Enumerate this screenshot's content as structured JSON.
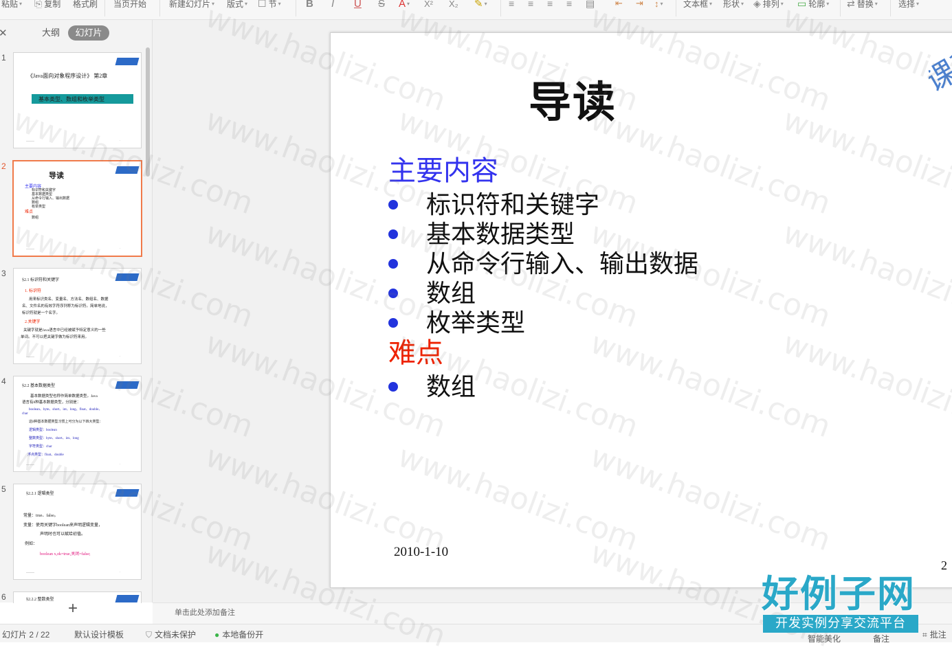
{
  "toolbar": {
    "paste": "粘贴",
    "copy": "复制",
    "format_painter": "格式刷",
    "current_page_start": "当页开始",
    "new_slide": "新建幻灯片",
    "layout": "版式",
    "section": "节",
    "bold": "B",
    "italic": "I",
    "underline": "U",
    "strikethrough": "S",
    "font_color": "A",
    "superscript": "X²",
    "subscript": "X₂",
    "textbox": "文本框",
    "shape": "形状",
    "arrange": "排列",
    "outline": "轮廓",
    "replace": "替换",
    "select": "选择"
  },
  "left_panel": {
    "tab_outline": "大纲",
    "tab_slides": "幻灯片",
    "add_slide": "+",
    "thumbnails": [
      {
        "num": "1",
        "title": "《Java面向对象程序设计》 第2章",
        "subtitle": "基本类型、数组和枚举类型"
      },
      {
        "num": "2",
        "title": "导读",
        "lines": [
          "主要内容",
          "标识符和关键字",
          "基本数据类型",
          "从命令行输入、输出数据",
          "数组",
          "枚举类型",
          "难点",
          "数组"
        ]
      },
      {
        "num": "3",
        "title": "§2.1 标识符和关键字",
        "lines": [
          "1. 标识符",
          "用来标识类名、变量名、方法名、数组名、数据",
          "名、文件名的有效字符序列称为标识符。简单地说，",
          "标识符就是一个名字。",
          "2.关键字",
          "关键字就是Java语言中已经被赋予特定意义的一些",
          "单词。不可以把关键字做为标识符来用。"
        ]
      },
      {
        "num": "4",
        "title": "§2.2 基本数据类型",
        "lines": [
          "基本数据类型也称作简单数据类型。Java",
          "语言有8种基本数据类型，分别是：",
          "boolean、byte、short、int、long、float、double、",
          "char",
          "这8种基本数据类型习惯上可分为以下四大类型：",
          "逻辑类型：boolean",
          "整数类型：byte、short、int、long",
          "字符类型：char",
          "浮点类型：float、double"
        ]
      },
      {
        "num": "5",
        "title": "§2.2.1 逻辑类型",
        "lines": [
          "常量：true、false。",
          "变量：使用关键字boolean来声明逻辑变量，",
          "声明时也可以赋给初值。",
          "例如：",
          "boolean x,ok=true,关闭=false;"
        ]
      },
      {
        "num": "6",
        "title": "§2.2.2 整数类型"
      }
    ]
  },
  "slide": {
    "title": "导读",
    "section_main": "主要内容",
    "bullets": [
      "标识符和关键字",
      "基本数据类型",
      "从命令行输入、输出数据",
      "数组",
      "枚举类型"
    ],
    "section_difficult": "难点",
    "difficult_bullets": [
      "数组"
    ],
    "date": "2010-1-10",
    "page_num": "2",
    "colors": {
      "main_heading": "#3333ee",
      "difficult_heading": "#ee2200",
      "bullet_dot": "#2233dd"
    }
  },
  "notes": {
    "placeholder": "单击此处添加备注"
  },
  "statusbar": {
    "slide_indicator": "幻灯片 2 / 22",
    "template": "默认设计模板",
    "doc_protect": "文档未保护",
    "local_backup": "本地备份开",
    "smart_beautify": "智能美化",
    "notes": "备注",
    "comments": "批注"
  },
  "watermark": {
    "text": "www.haolizi.com",
    "brand": "好例子网",
    "brand_sub": "开发实例分享交流平台"
  }
}
